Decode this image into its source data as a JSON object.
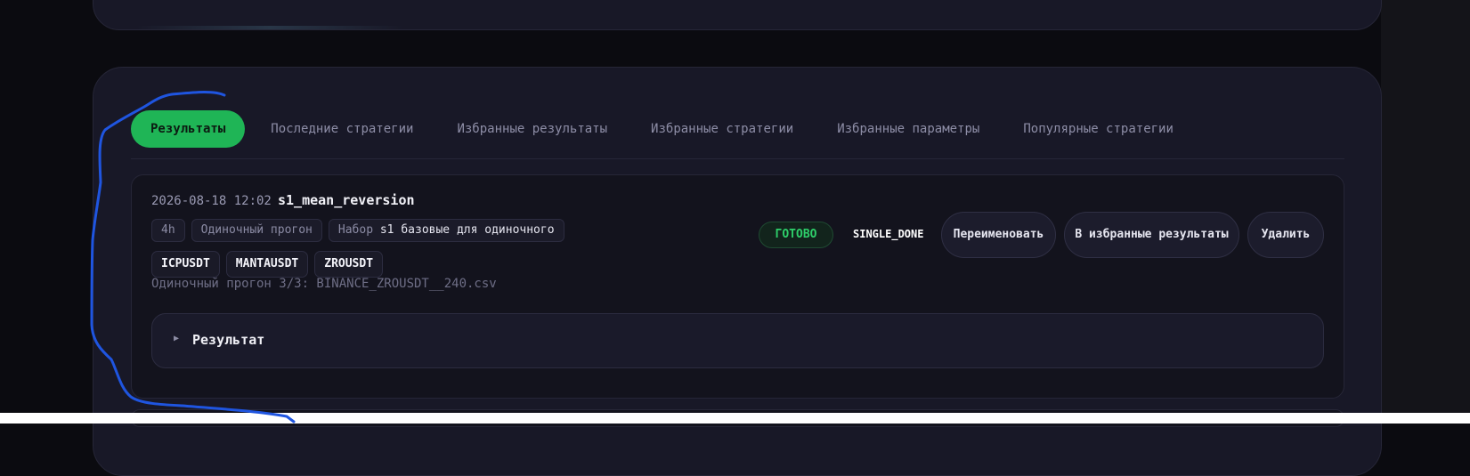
{
  "tabs": [
    {
      "label": "Результаты",
      "active": true
    },
    {
      "label": "Последние стратегии"
    },
    {
      "label": "Избранные результаты"
    },
    {
      "label": "Избранные стратегии"
    },
    {
      "label": "Избранные параметры"
    },
    {
      "label": "Популярные стратегии"
    }
  ],
  "run": {
    "date": "2026-08-18 12:02",
    "name": "s1_mean_reversion",
    "timeframe": "4h",
    "mode": "Одиночный прогон",
    "set_prefix": "Набор",
    "set_value": "s1 базовые для одиночного",
    "tickers": [
      "ICPUSDT",
      "MANTAUSDT",
      "ZROUSDT"
    ],
    "progress": "Одиночный прогон 3/3: BINANCE_ZROUSDT__240.csv",
    "status": "ГОТОВО",
    "state_code": "SINGLE_DONE",
    "actions": {
      "rename": "Переименовать",
      "favorite": "В избранные результаты",
      "delete": "Удалить"
    },
    "result_label": "Результат"
  },
  "colors": {
    "accent": "#1fb556",
    "background": "#0b0b10",
    "card": "#181827",
    "annotation_stroke": "#1f55e0"
  },
  "icons": {
    "expand": "triangle-right-icon"
  }
}
